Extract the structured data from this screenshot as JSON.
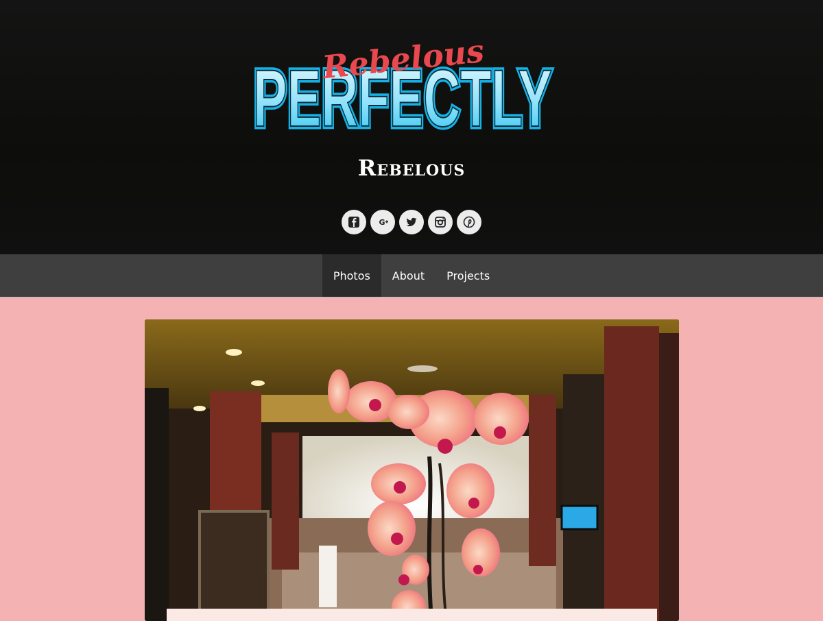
{
  "site": {
    "logo_big_text": "PERFECTLY",
    "logo_script_text": "Rebelous",
    "title": "Rebelous"
  },
  "social": [
    {
      "name": "facebook-icon",
      "label": "Facebook"
    },
    {
      "name": "google-plus-icon",
      "label": "Google+"
    },
    {
      "name": "twitter-icon",
      "label": "Twitter"
    },
    {
      "name": "instagram-icon",
      "label": "Instagram"
    },
    {
      "name": "pinterest-icon",
      "label": "Pinterest"
    }
  ],
  "nav": {
    "items": [
      {
        "label": "Photos",
        "active": true
      },
      {
        "label": "About",
        "active": false
      },
      {
        "label": "Projects",
        "active": false
      }
    ]
  },
  "colors": {
    "header_bg": "#111111",
    "nav_bg": "#3f3f3f",
    "nav_active_bg": "#2b2b2b",
    "page_bg": "#f4b2b3",
    "logo_cyan": "#1ab8ea",
    "logo_red": "#e8484e"
  }
}
